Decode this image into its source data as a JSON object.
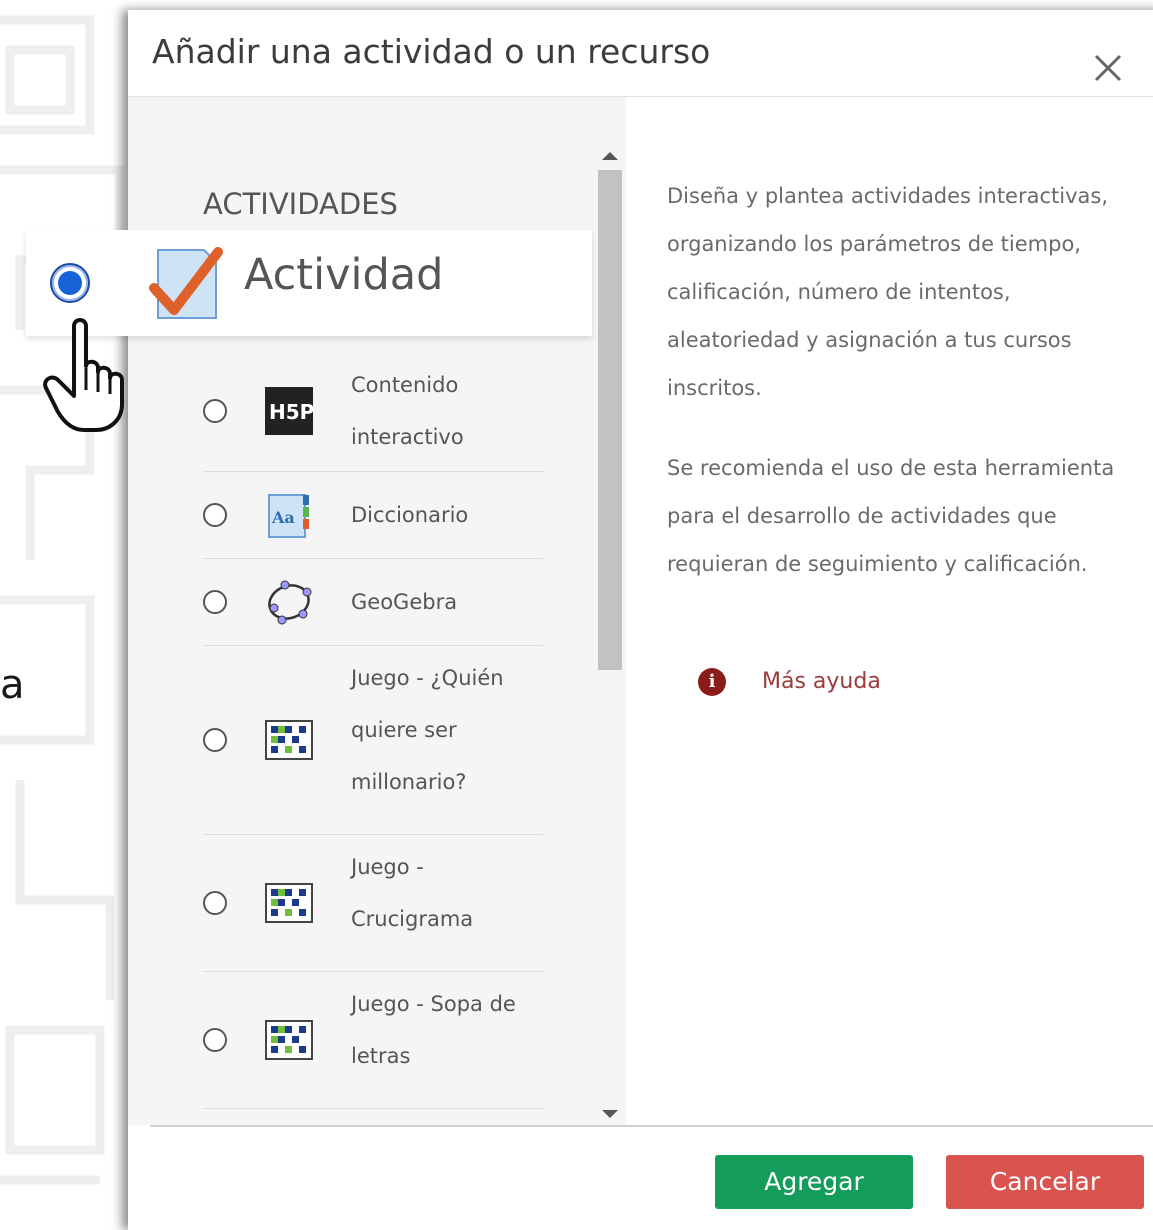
{
  "background": {
    "partial_text": "a"
  },
  "modal": {
    "title": "Añadir una actividad o un recurso",
    "section_label": "ACTIVIDADES",
    "selected_item": {
      "label": "Actividad",
      "icon": "assignment-check-icon"
    },
    "items": [
      {
        "label": "Contenido interactivo",
        "icon": "h5p-icon"
      },
      {
        "label": "Diccionario",
        "icon": "glossary-icon"
      },
      {
        "label": "GeoGebra",
        "icon": "geogebra-icon"
      },
      {
        "label": "Juego - ¿Quién quiere ser millonario?",
        "icon": "game-grid-icon"
      },
      {
        "label": "Juego - Crucigrama",
        "icon": "game-grid-icon"
      },
      {
        "label": "Juego - Sopa de letras",
        "icon": "game-grid-icon"
      }
    ],
    "description": {
      "paragraph1": "Diseña y plantea actividades interactivas, organizando los parámetros de tiempo, calificación, número de intentos, aleatoriedad y asignación a tus cursos inscritos.",
      "paragraph2": "Se recomienda el uso de esta herramienta para el desarrollo de actividades que requieran de seguimiento y calificación."
    },
    "help_link": "Más ayuda",
    "buttons": {
      "add": "Agregar",
      "cancel": "Cancelar"
    }
  },
  "colors": {
    "add_button": "#149c5a",
    "cancel_button": "#d9534f",
    "help_icon": "#8b1c1c",
    "selected_radio": "#1563d6"
  }
}
